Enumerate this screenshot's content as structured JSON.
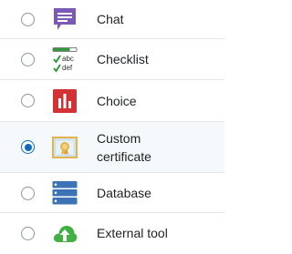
{
  "options": [
    {
      "label": "Chat",
      "icon": "chat-icon",
      "selected": false
    },
    {
      "label": "Checklist",
      "icon": "checklist-icon",
      "selected": false
    },
    {
      "label": "Choice",
      "icon": "choice-icon",
      "selected": false
    },
    {
      "label_line1": "Custom",
      "label_line2": "certificate",
      "icon": "certificate-icon",
      "selected": true
    },
    {
      "label": "Database",
      "icon": "database-icon",
      "selected": false
    },
    {
      "label": "External tool",
      "icon": "external-tool-icon",
      "selected": false
    }
  ],
  "colors": {
    "chat_icon": "#7b5ab6",
    "checklist_check": "#2e9c3a",
    "choice_icon": "#d33235",
    "certificate_icon": "#e4b44a",
    "database_icon": "#3b73b5",
    "external_tool_icon": "#43b043",
    "radio_selected": "#0f6cbf",
    "selected_row_bg": "#f5f9fc"
  }
}
